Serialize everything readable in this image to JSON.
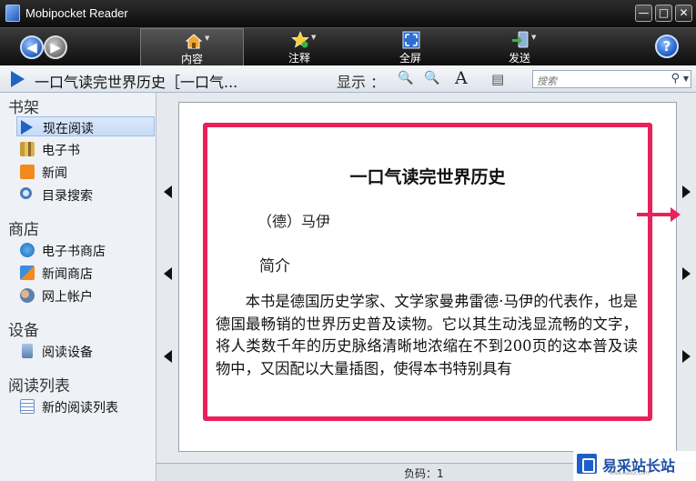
{
  "window": {
    "title": "Mobipocket Reader",
    "min_glyph": "—",
    "max_glyph": "□",
    "close_glyph": "✕"
  },
  "toolbar": {
    "back_glyph": "◀",
    "forward_glyph": "▶",
    "buttons": [
      {
        "label": "内容",
        "icon": "home-icon",
        "active": true
      },
      {
        "label": "注释",
        "icon": "star-icon",
        "active": false
      },
      {
        "label": "全屏",
        "icon": "fullscreen-icon",
        "active": false
      },
      {
        "label": "发送",
        "icon": "send-device-icon",
        "active": false
      }
    ],
    "help_glyph": "?"
  },
  "infobar": {
    "book_title": "一口气读完世界历史［一口气...",
    "display_label": "显示 ：",
    "zoom_in_glyph": "🔍",
    "zoom_out_glyph": "🔍",
    "font_glyph": "A",
    "layout_glyph": "▤",
    "search_placeholder": "搜索"
  },
  "sidebar": {
    "sections": [
      {
        "title": "书架",
        "items": [
          "现在阅读",
          "电子书",
          "新闻",
          "目录搜索"
        ]
      },
      {
        "title": "商店",
        "items": [
          "电子书商店",
          "新闻商店",
          "网上帐户"
        ]
      },
      {
        "title": "设备",
        "items": [
          "阅读设备"
        ]
      },
      {
        "title": "阅读列表",
        "items": [
          "新的阅读列表"
        ]
      }
    ],
    "selected": "现在阅读"
  },
  "page": {
    "title": "一口气读完世界历史",
    "author": "（德）马伊",
    "intro_heading": "简介",
    "body": "本书是德国历史学家、文学家曼弗雷德·马伊的代表作，也是德国最畅销的世界历史普及读物。它以其生动浅显流畅的文字，将人类数千年的历史脉络清晰地浓缩在不到200页的这本普及读物中，又因配以大量插图，使得本书特别具有"
  },
  "status": {
    "location": "负码：1"
  },
  "watermark": {
    "text": "易采站长站",
    "url": "www.easck.com"
  },
  "colors": {
    "highlight": "#e8215a",
    "accent": "#1f63c7"
  }
}
